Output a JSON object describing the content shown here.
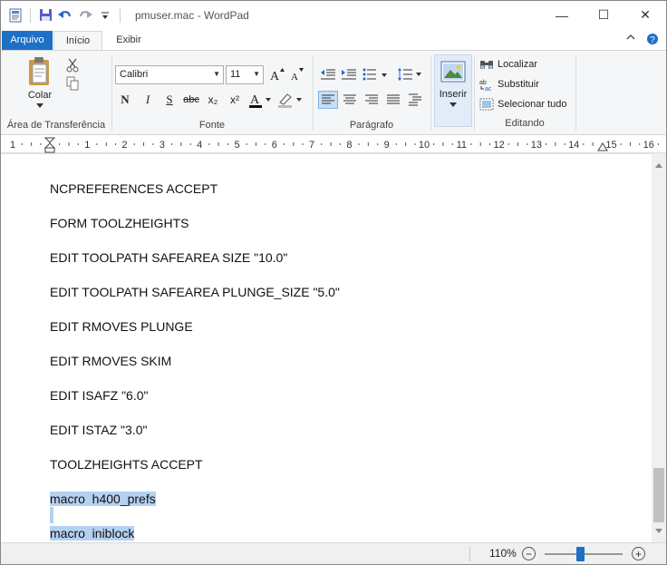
{
  "window": {
    "title": "pmuser.mac - WordPad",
    "controls": {
      "minimize": "—",
      "maximize": "☐",
      "close": "✕"
    }
  },
  "quick_access": {
    "icons": [
      "wordpad-app-icon",
      "save-icon",
      "undo-icon",
      "redo-icon",
      "customize-qa-icon"
    ]
  },
  "tabs": {
    "file": "Arquivo",
    "home": "Início",
    "view": "Exibir"
  },
  "ribbon": {
    "clipboard": {
      "paste": "Colar",
      "label": "Área de Transferência"
    },
    "font": {
      "family": "Calibri",
      "size": "11",
      "label": "Fonte",
      "bold": "N",
      "italic": "I",
      "underline": "S",
      "strike": "abc",
      "subscript": "x₂",
      "superscript": "x²"
    },
    "paragraph": {
      "label": "Parágrafo"
    },
    "insert": {
      "label": "Inserir"
    },
    "editing": {
      "find": "Localizar",
      "replace": "Substituir",
      "select_all": "Selecionar tudo",
      "label": "Editando"
    }
  },
  "ruler": {
    "labels": [
      "1",
      "1",
      "2",
      "3",
      "4",
      "5",
      "6",
      "7",
      "8",
      "9",
      "10",
      "11",
      "12",
      "13",
      "14",
      "15",
      "16"
    ]
  },
  "document": {
    "lines": [
      "NCPREFERENCES ACCEPT",
      "FORM TOOLZHEIGHTS",
      "EDIT TOOLPATH SAFEAREA SIZE \"10.0\"",
      "EDIT TOOLPATH SAFEAREA PLUNGE_SIZE \"5.0\"",
      "EDIT RMOVES PLUNGE",
      "EDIT RMOVES SKIM",
      "EDIT ISAFZ \"6.0\"",
      "EDIT ISTAZ \"3.0\"",
      "TOOLZHEIGHTS ACCEPT"
    ],
    "selected_lines": [
      "macro  h400_prefs",
      "macro  iniblock"
    ]
  },
  "status": {
    "zoom": "110%",
    "zoom_out": "−",
    "zoom_in": "+",
    "zoom_level": 0.45
  }
}
